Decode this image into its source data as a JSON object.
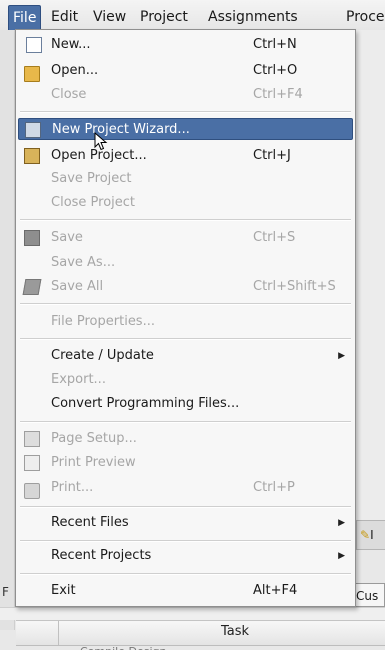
{
  "menubar": {
    "items": [
      {
        "label": "File"
      },
      {
        "label": "Edit"
      },
      {
        "label": "View"
      },
      {
        "label": "Project"
      },
      {
        "label": "Assignments"
      },
      {
        "label": "Proce"
      }
    ]
  },
  "file_menu": {
    "items": [
      {
        "label": "New...",
        "shortcut": "Ctrl+N",
        "icon": "new-file-icon",
        "enabled": true
      },
      {
        "label": "Open...",
        "shortcut": "Ctrl+O",
        "icon": "open-folder-icon",
        "enabled": true
      },
      {
        "label": "Close",
        "shortcut": "Ctrl+F4",
        "enabled": false
      },
      {
        "label": "New Project Wizard...",
        "icon": "wizard-icon",
        "enabled": true,
        "highlighted": true
      },
      {
        "label": "Open Project...",
        "shortcut": "Ctrl+J",
        "icon": "open-project-icon",
        "enabled": true
      },
      {
        "label": "Save Project",
        "enabled": false
      },
      {
        "label": "Close Project",
        "enabled": false
      },
      {
        "label": "Save",
        "shortcut": "Ctrl+S",
        "icon": "save-icon",
        "enabled": false
      },
      {
        "label": "Save As...",
        "enabled": false
      },
      {
        "label": "Save All",
        "shortcut": "Ctrl+Shift+S",
        "icon": "save-all-icon",
        "enabled": false
      },
      {
        "label": "File Properties...",
        "enabled": false
      },
      {
        "label": "Create / Update",
        "submenu": true,
        "enabled": true
      },
      {
        "label": "Export...",
        "enabled": false
      },
      {
        "label": "Convert Programming Files...",
        "enabled": true
      },
      {
        "label": "Page Setup...",
        "icon": "page-setup-icon",
        "enabled": false
      },
      {
        "label": "Print Preview",
        "icon": "print-preview-icon",
        "enabled": false
      },
      {
        "label": "Print...",
        "shortcut": "Ctrl+P",
        "icon": "print-icon",
        "enabled": false
      },
      {
        "label": "Recent Files",
        "submenu": true,
        "enabled": true
      },
      {
        "label": "Recent Projects",
        "submenu": true,
        "enabled": true
      },
      {
        "label": "Exit",
        "shortcut": "Alt+F4",
        "enabled": true
      }
    ]
  },
  "background": {
    "right_tab_text": "I",
    "right_tab2_text": "Cus",
    "left_letter": "F",
    "table_header_task": "Task",
    "partial_row_text": "Compile Design"
  },
  "colors": {
    "highlight": "#4a6fa5",
    "disabled_text": "#a6a6a6"
  }
}
